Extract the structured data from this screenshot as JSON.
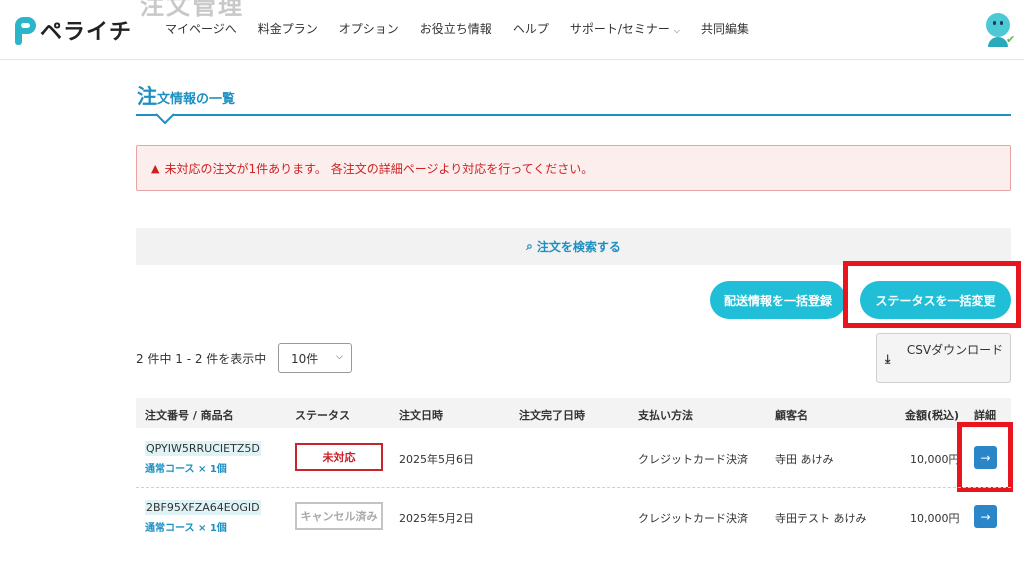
{
  "header": {
    "ghost_title": "注文管理",
    "logo_text": "ペライチ",
    "nav": [
      {
        "label": "マイページへ"
      },
      {
        "label": "料金プラン"
      },
      {
        "label": "オプション"
      },
      {
        "label": "お役立ち情報"
      },
      {
        "label": "ヘルプ"
      },
      {
        "label": "サポート/セミナー",
        "has_dropdown": true
      },
      {
        "label": "共同編集"
      }
    ]
  },
  "section": {
    "title_first": "注",
    "title_rest": "文情報の一覧"
  },
  "alert": {
    "icon": "warning-icon",
    "text": "未対応の注文が1件あります。 各注文の詳細ページより対応を行ってください。"
  },
  "search": {
    "label": "注文を検索する",
    "icon": "search-icon"
  },
  "actions": {
    "shipping_label": "配送情報を一括登録",
    "status_label": "ステータスを一括変更"
  },
  "list": {
    "count_text": "2 件中 1 - 2 件を表示中",
    "per_page": "10件",
    "csv_label": "CSVダウンロード"
  },
  "table": {
    "headers": {
      "order": "注文番号 / 商品名",
      "status": "ステータス",
      "order_date": "注文日時",
      "completed_date": "注文完了日時",
      "payment": "支払い方法",
      "customer": "顧客名",
      "amount": "金額(税込)",
      "detail": "詳細"
    },
    "rows": [
      {
        "order_id": "QPYIW5RRUCIETZ5D",
        "product": "通常コース × 1個",
        "status": "未対応",
        "order_date": "2025年5月6日",
        "completed_date": "",
        "payment": "クレジットカード決済",
        "customer": "寺田 あけみ",
        "amount": "10,000円"
      },
      {
        "order_id": "2BF95XFZA64EOGID",
        "product": "通常コース × 1個",
        "status": "キャンセル済み",
        "order_date": "2025年5月2日",
        "completed_date": "",
        "payment": "クレジットカード決済",
        "customer": "寺田テスト あけみ",
        "amount": "10,000円"
      }
    ]
  },
  "colors": {
    "accent": "#1e8fc1",
    "button": "#21bfd7",
    "highlight": "#e8141e",
    "alert_text": "#cc2222"
  }
}
